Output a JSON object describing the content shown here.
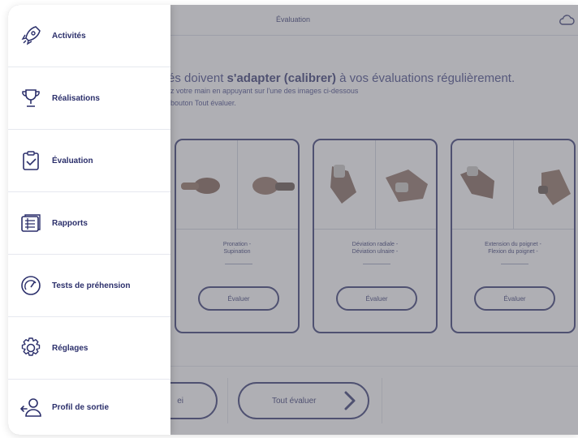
{
  "app": {
    "title": "Évaluation",
    "headline_prefix": "vités doivent ",
    "headline_bold": "s'adapter (calibrer)",
    "headline_suffix": " à vos évaluations régulièrement.",
    "subline_1": "z votre main en appuyant sur l'une des images ci-dessous",
    "subline_2": "bouton Tout évaluer."
  },
  "cards": [
    {
      "label_a": "Pronation -",
      "label_b": "Supination",
      "button": "Évaluer"
    },
    {
      "label_a": "Déviation radiale -",
      "label_b": "Déviation ulnaire -",
      "button": "Évaluer"
    },
    {
      "label_a": "Extension du poignet -",
      "label_b": "Flexion du poignet -",
      "button": "Évaluer"
    }
  ],
  "footer": {
    "left_button": "ei",
    "main_button": "Tout évaluer"
  },
  "menu": {
    "items": [
      {
        "label": "Activités",
        "icon": "rocket-icon"
      },
      {
        "label": "Réalisations",
        "icon": "trophy-icon"
      },
      {
        "label": "Évaluation",
        "icon": "clipboard-check-icon"
      },
      {
        "label": "Rapports",
        "icon": "report-list-icon"
      },
      {
        "label": "Tests de préhension",
        "icon": "gauge-icon"
      },
      {
        "label": "Réglages",
        "icon": "gear-icon"
      },
      {
        "label": "Profil de sortie",
        "icon": "user-exit-icon"
      }
    ]
  },
  "colors": {
    "primary": "#2b2f6b",
    "overlay": "#6e6e76",
    "background": "#ffffff"
  }
}
